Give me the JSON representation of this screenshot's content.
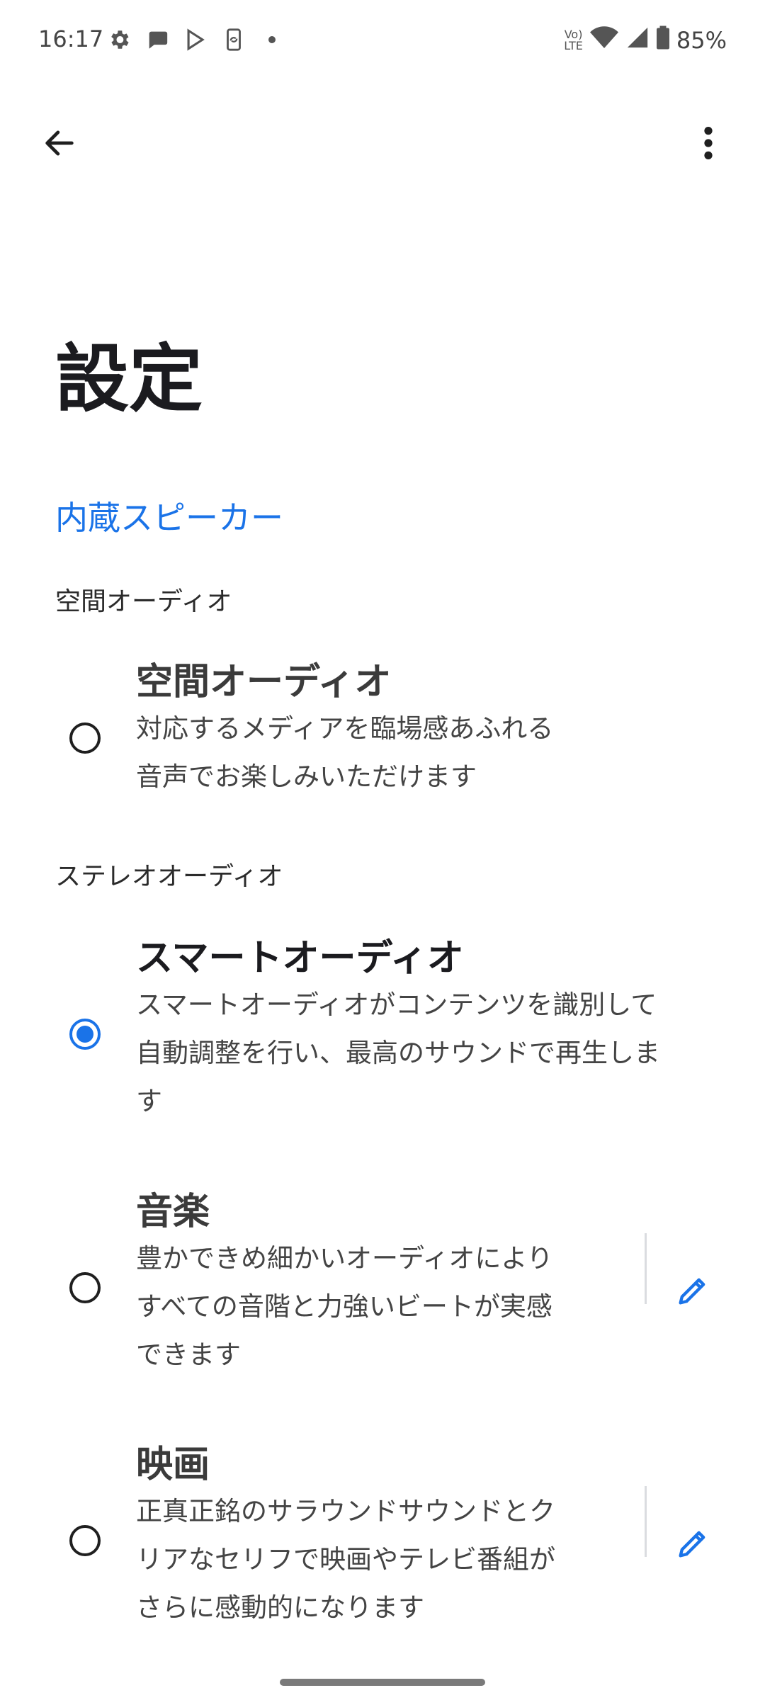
{
  "status_bar": {
    "time": "16:17",
    "battery": "85%",
    "icons_left": [
      "gear-icon",
      "chat-icon",
      "play-store-icon",
      "sync-icon",
      "dot-icon"
    ],
    "icons_right": [
      "volte-icon",
      "wifi-icon",
      "cell-signal-icon",
      "battery-icon"
    ]
  },
  "app_bar": {
    "back_icon": "arrow-back-icon",
    "more_icon": "more-vert-icon"
  },
  "page": {
    "title": "設定",
    "section_header": "内蔵スピーカー"
  },
  "groups": [
    {
      "label": "空間オーディオ",
      "options": [
        {
          "title": "空間オーディオ",
          "description_lines": [
            "対応するメディアを臨場感あふれる",
            "音声でお楽しみいただけます"
          ],
          "selected": false,
          "editable": false
        }
      ]
    },
    {
      "label": "ステレオオーディオ",
      "options": [
        {
          "title": "スマートオーディオ",
          "description_lines": [
            "スマートオーディオがコンテンツを識別して",
            "自動調整を行い、最高のサウンドで再生しま",
            "す"
          ],
          "selected": true,
          "editable": false
        },
        {
          "title": "音楽",
          "description_lines": [
            "豊かできめ細かいオーディオにより",
            "すべての音階と力強いビートが実感",
            "できます"
          ],
          "selected": false,
          "editable": true
        },
        {
          "title": "映画",
          "description_lines": [
            "正真正銘のサラウンドサウンドとク",
            "リアなセリフで映画やテレビ番組が",
            "さらに感動的になります"
          ],
          "selected": false,
          "editable": true
        }
      ]
    }
  ],
  "colors": {
    "accent": "#1a73e8",
    "text_primary": "#1b1b1f",
    "text_secondary": "#444444"
  }
}
